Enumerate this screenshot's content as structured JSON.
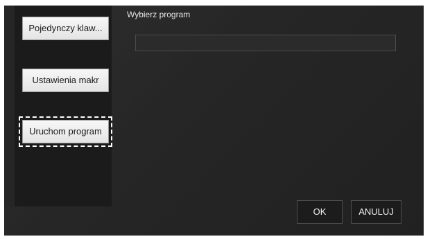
{
  "sidebar": {
    "items": [
      {
        "label": "Pojedynczy klaw..."
      },
      {
        "label": "Ustawienia makr"
      },
      {
        "label": "Uruchom program"
      }
    ]
  },
  "main": {
    "prompt_label": "Wybierz program",
    "program_path": {
      "value": "",
      "placeholder": ""
    }
  },
  "footer": {
    "ok_label": "OK",
    "cancel_label": "ANULUJ"
  },
  "colors": {
    "background": "#262626",
    "sidebar": "#1b1b1b",
    "button_light": "#f0f0f0",
    "text": "#e6e6e6"
  }
}
